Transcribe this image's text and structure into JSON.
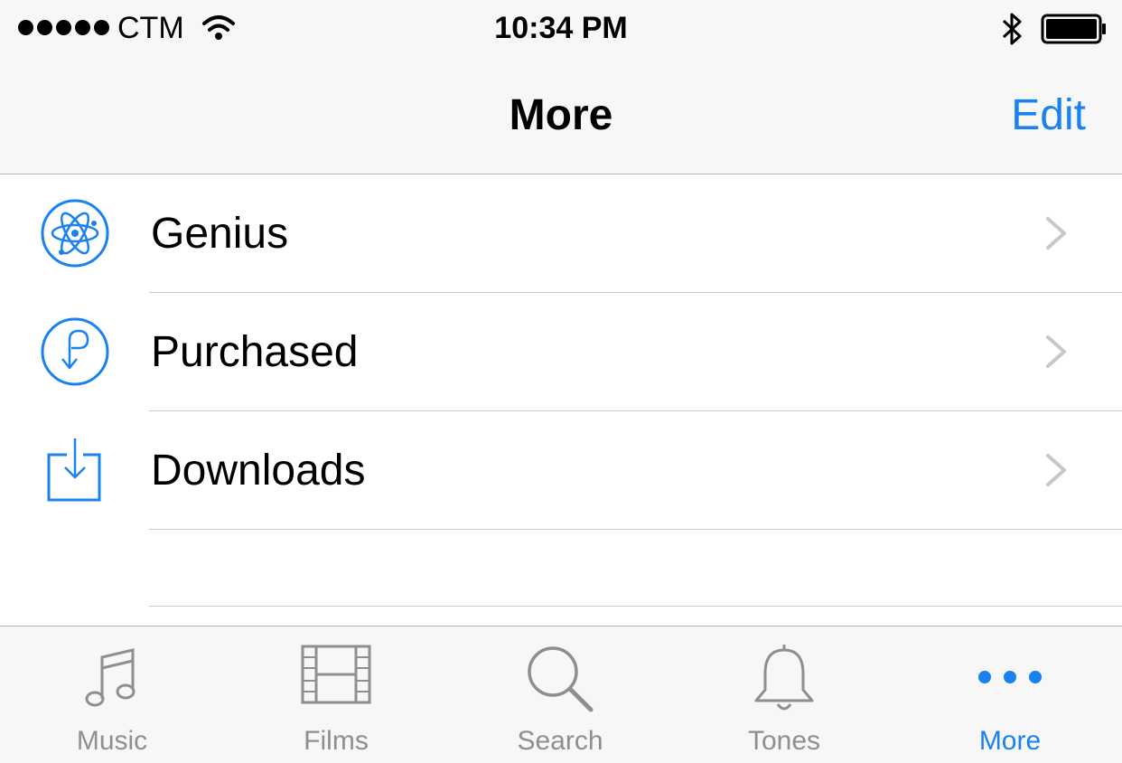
{
  "status_bar": {
    "carrier": "CTM",
    "time": "10:34 PM",
    "signal_icon": "signal-dots-icon",
    "wifi_icon": "wifi-icon",
    "bluetooth_icon": "bluetooth-icon",
    "battery_icon": "battery-icon"
  },
  "nav": {
    "title": "More",
    "edit_label": "Edit"
  },
  "list": {
    "items": [
      {
        "label": "Genius",
        "icon": "genius-atom-icon"
      },
      {
        "label": "Purchased",
        "icon": "purchased-icon"
      },
      {
        "label": "Downloads",
        "icon": "downloads-icon"
      }
    ]
  },
  "tabs": {
    "items": [
      {
        "label": "Music",
        "icon": "music-note-icon",
        "active": false
      },
      {
        "label": "Films",
        "icon": "film-strip-icon",
        "active": false
      },
      {
        "label": "Search",
        "icon": "search-icon",
        "active": false
      },
      {
        "label": "Tones",
        "icon": "bell-icon",
        "active": false
      },
      {
        "label": "More",
        "icon": "more-dots-icon",
        "active": true
      }
    ]
  },
  "colors": {
    "accent": "#1a82f0",
    "inactive": "#8e8e93",
    "bar_background": "#f7f7f7",
    "separator": "#c8c7cc"
  }
}
